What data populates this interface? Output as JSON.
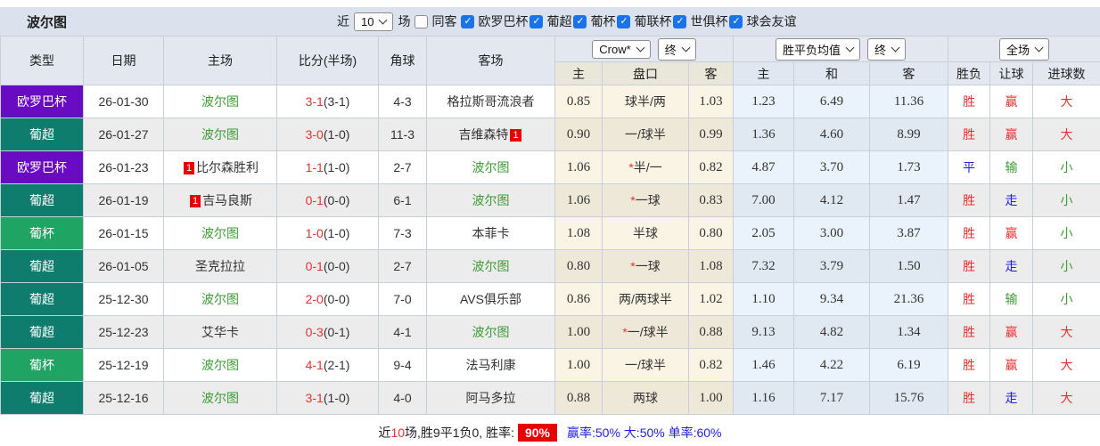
{
  "header": {
    "title": "波尔图"
  },
  "controls": {
    "near_label": "近",
    "match_count": "10",
    "games_label": "场",
    "same_venue": {
      "label": "同客",
      "checked": false
    },
    "leagues": [
      {
        "label": "欧罗巴杯",
        "checked": true
      },
      {
        "label": "葡超",
        "checked": true
      },
      {
        "label": "葡杯",
        "checked": true
      },
      {
        "label": "葡联杯",
        "checked": true
      },
      {
        "label": "世俱杯",
        "checked": true
      },
      {
        "label": "球会友谊",
        "checked": true
      }
    ]
  },
  "table": {
    "left_headers": [
      "类型",
      "日期",
      "主场",
      "比分(半场)",
      "角球",
      "客场"
    ],
    "selects": {
      "bookmaker": "Crow*",
      "bookmaker_final": "终",
      "avg": "胜平负均值",
      "avg_final": "终",
      "scope": "全场"
    },
    "sub_headers": [
      "主",
      "盘口",
      "客",
      "主",
      "和",
      "客",
      "胜负",
      "让球",
      "进球数"
    ],
    "rows": [
      {
        "league": "欧罗巴杯",
        "league_color": "purple",
        "date": "26-01-30",
        "home": {
          "name": "波尔图",
          "self": true
        },
        "score": "3-1",
        "half": "(3-1)",
        "corners": "4-3",
        "away": {
          "name": "格拉斯哥流浪者",
          "self": false
        },
        "odds_home": "0.85",
        "handicap": "球半/两",
        "star": false,
        "odds_away": "1.03",
        "avg_home": "1.23",
        "avg_draw": "6.49",
        "avg_away": "11.36",
        "outcome": {
          "text": "胜",
          "c": "red"
        },
        "let": {
          "text": "赢",
          "c": "red"
        },
        "goals": {
          "text": "大",
          "c": "red"
        }
      },
      {
        "league": "葡超",
        "league_color": "teal",
        "date": "26-01-27",
        "home": {
          "name": "波尔图",
          "self": true
        },
        "score": "3-0",
        "half": "(1-0)",
        "corners": "11-3",
        "away": {
          "name": "吉维森特",
          "self": false,
          "badge": "1",
          "badge_pos": "after"
        },
        "odds_home": "0.90",
        "handicap": "一/球半",
        "star": false,
        "odds_away": "0.99",
        "avg_home": "1.36",
        "avg_draw": "4.60",
        "avg_away": "8.99",
        "outcome": {
          "text": "胜",
          "c": "red"
        },
        "let": {
          "text": "赢",
          "c": "red"
        },
        "goals": {
          "text": "大",
          "c": "red"
        }
      },
      {
        "league": "欧罗巴杯",
        "league_color": "purple",
        "date": "26-01-23",
        "home": {
          "name": "比尔森胜利",
          "self": false,
          "badge": "1",
          "badge_pos": "before"
        },
        "score": "1-1",
        "half": "(1-0)",
        "corners": "2-7",
        "away": {
          "name": "波尔图",
          "self": true
        },
        "odds_home": "1.06",
        "handicap": "半/一",
        "star": true,
        "odds_away": "0.82",
        "avg_home": "4.87",
        "avg_draw": "3.70",
        "avg_away": "1.73",
        "outcome": {
          "text": "平",
          "c": "blue"
        },
        "let": {
          "text": "输",
          "c": "green"
        },
        "goals": {
          "text": "小",
          "c": "green"
        }
      },
      {
        "league": "葡超",
        "league_color": "teal",
        "date": "26-01-19",
        "home": {
          "name": "吉马良斯",
          "self": false,
          "badge": "1",
          "badge_pos": "before"
        },
        "score": "0-1",
        "half": "(0-0)",
        "corners": "6-1",
        "away": {
          "name": "波尔图",
          "self": true
        },
        "odds_home": "1.06",
        "handicap": "一球",
        "star": true,
        "odds_away": "0.83",
        "avg_home": "7.00",
        "avg_draw": "4.12",
        "avg_away": "1.47",
        "outcome": {
          "text": "胜",
          "c": "red"
        },
        "let": {
          "text": "走",
          "c": "blue"
        },
        "goals": {
          "text": "小",
          "c": "green"
        }
      },
      {
        "league": "葡杯",
        "league_color": "green",
        "date": "26-01-15",
        "home": {
          "name": "波尔图",
          "self": true
        },
        "score": "1-0",
        "half": "(1-0)",
        "corners": "7-3",
        "away": {
          "name": "本菲卡",
          "self": false
        },
        "odds_home": "1.08",
        "handicap": "半球",
        "star": false,
        "odds_away": "0.80",
        "avg_home": "2.05",
        "avg_draw": "3.00",
        "avg_away": "3.87",
        "outcome": {
          "text": "胜",
          "c": "red"
        },
        "let": {
          "text": "赢",
          "c": "red"
        },
        "goals": {
          "text": "小",
          "c": "green"
        }
      },
      {
        "league": "葡超",
        "league_color": "teal",
        "date": "26-01-05",
        "home": {
          "name": "圣克拉拉",
          "self": false
        },
        "score": "0-1",
        "half": "(0-0)",
        "corners": "2-7",
        "away": {
          "name": "波尔图",
          "self": true
        },
        "odds_home": "0.80",
        "handicap": "一球",
        "star": true,
        "odds_away": "1.08",
        "avg_home": "7.32",
        "avg_draw": "3.79",
        "avg_away": "1.50",
        "outcome": {
          "text": "胜",
          "c": "red"
        },
        "let": {
          "text": "走",
          "c": "blue"
        },
        "goals": {
          "text": "小",
          "c": "green"
        }
      },
      {
        "league": "葡超",
        "league_color": "teal",
        "date": "25-12-30",
        "home": {
          "name": "波尔图",
          "self": true
        },
        "score": "2-0",
        "half": "(0-0)",
        "corners": "7-0",
        "away": {
          "name": "AVS俱乐部",
          "self": false
        },
        "odds_home": "0.86",
        "handicap": "两/两球半",
        "star": false,
        "odds_away": "1.02",
        "avg_home": "1.10",
        "avg_draw": "9.34",
        "avg_away": "21.36",
        "outcome": {
          "text": "胜",
          "c": "red"
        },
        "let": {
          "text": "输",
          "c": "green"
        },
        "goals": {
          "text": "小",
          "c": "green"
        }
      },
      {
        "league": "葡超",
        "league_color": "teal",
        "date": "25-12-23",
        "home": {
          "name": "艾华卡",
          "self": false
        },
        "score": "0-3",
        "half": "(0-1)",
        "corners": "4-1",
        "away": {
          "name": "波尔图",
          "self": true
        },
        "odds_home": "1.00",
        "handicap": "一/球半",
        "star": true,
        "odds_away": "0.88",
        "avg_home": "9.13",
        "avg_draw": "4.82",
        "avg_away": "1.34",
        "outcome": {
          "text": "胜",
          "c": "red"
        },
        "let": {
          "text": "赢",
          "c": "red"
        },
        "goals": {
          "text": "大",
          "c": "red"
        }
      },
      {
        "league": "葡杯",
        "league_color": "green",
        "date": "25-12-19",
        "home": {
          "name": "波尔图",
          "self": true
        },
        "score": "4-1",
        "half": "(2-1)",
        "corners": "9-4",
        "away": {
          "name": "法马利康",
          "self": false
        },
        "odds_home": "1.00",
        "handicap": "一/球半",
        "star": false,
        "odds_away": "0.82",
        "avg_home": "1.46",
        "avg_draw": "4.22",
        "avg_away": "6.19",
        "outcome": {
          "text": "胜",
          "c": "red"
        },
        "let": {
          "text": "赢",
          "c": "red"
        },
        "goals": {
          "text": "大",
          "c": "red"
        }
      },
      {
        "league": "葡超",
        "league_color": "teal",
        "date": "25-12-16",
        "home": {
          "name": "波尔图",
          "self": true
        },
        "score": "3-1",
        "half": "(1-0)",
        "corners": "4-0",
        "away": {
          "name": "阿马多拉",
          "self": false
        },
        "odds_home": "0.88",
        "handicap": "两球",
        "star": false,
        "odds_away": "1.00",
        "avg_home": "1.16",
        "avg_draw": "7.17",
        "avg_away": "15.76",
        "outcome": {
          "text": "胜",
          "c": "red"
        },
        "let": {
          "text": "走",
          "c": "blue"
        },
        "goals": {
          "text": "大",
          "c": "red"
        }
      }
    ]
  },
  "footer": {
    "segments": [
      {
        "text": "近",
        "style": "plain"
      },
      {
        "text": "10",
        "style": "red"
      },
      {
        "text": "场,胜9平1负0, 胜率:",
        "style": "plain"
      },
      {
        "text": "90%",
        "style": "badge"
      },
      {
        "text": "赢率:50% 大:50% 单率:60%",
        "style": "blue"
      }
    ]
  },
  "colors": {
    "red": "#e63232",
    "blue": "#2323d6",
    "green": "#3c9b35",
    "badge_red": "#e60000",
    "league_colors": {
      "purple": "#6a0bc4",
      "teal": "#0e7d6e",
      "green": "#1fa463"
    }
  }
}
